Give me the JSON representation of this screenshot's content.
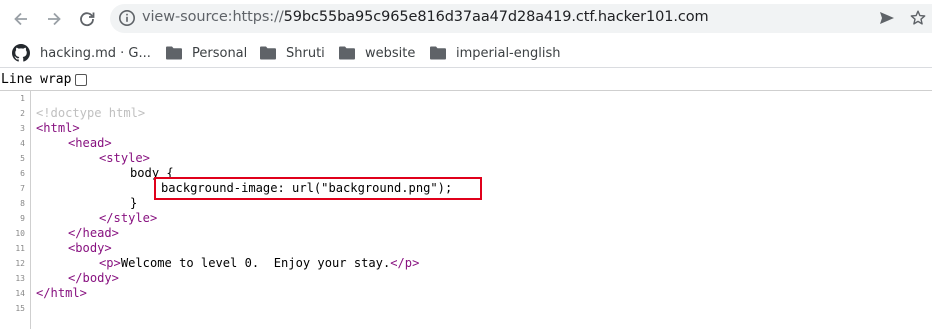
{
  "toolbar": {
    "url_scheme": "view-source:https://",
    "url_host": "59bc55ba95c965e816d37aa47d28a419.ctf.hacker101.com"
  },
  "bookmarks": [
    {
      "label": "hacking.md · G...",
      "icon": "github-icon"
    },
    {
      "label": "Personal",
      "icon": "folder-icon"
    },
    {
      "label": "Shruti",
      "icon": "folder-icon"
    },
    {
      "label": "website",
      "icon": "folder-icon"
    },
    {
      "label": "imperial-english",
      "icon": "folder-icon"
    }
  ],
  "line_wrap": {
    "label": "Line wrap",
    "checked": false
  },
  "source": {
    "line_numbers": [
      "1",
      "2",
      "3",
      "4",
      "5",
      "6",
      "7",
      "8",
      "9",
      "10",
      "11",
      "12",
      "13",
      "14",
      "15"
    ],
    "lines": [
      "",
      "<!doctype html>",
      "<html>",
      "<head>",
      "<style>",
      "body {",
      "background-image: url(\"background.png\");",
      "}",
      "</style>",
      "</head>",
      "<body>",
      "Welcome to level 0.  Enjoy your stay.",
      "</body>",
      "</html>",
      ""
    ],
    "tags": {
      "p_open": "<p>",
      "p_close": "</p>"
    }
  },
  "colors": {
    "tag": "#881280",
    "doctype": "#c0c0c0",
    "highlight": "#e0001b"
  }
}
